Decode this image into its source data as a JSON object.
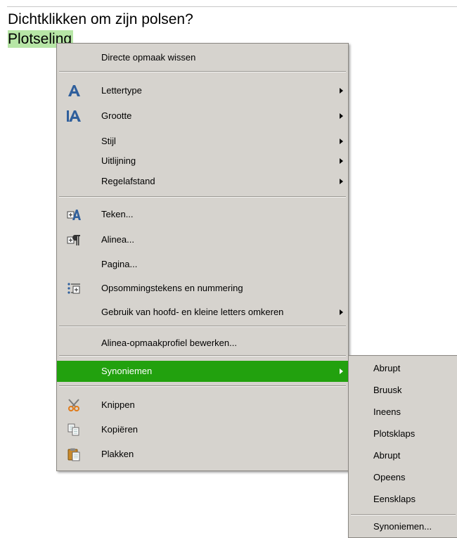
{
  "document": {
    "line1": "Dichtklikken om zijn polsen?",
    "selected_word": "Plotseling"
  },
  "context_menu": {
    "clear_formatting": "Directe opmaak wissen",
    "font": "Lettertype",
    "size": "Grootte",
    "style": "Stijl",
    "alignment": "Uitlijning",
    "line_spacing": "Regelafstand",
    "character": "Teken...",
    "paragraph": "Alinea...",
    "page": "Pagina...",
    "bullets": "Opsommingstekens en nummering",
    "change_case": "Gebruik van hoofd- en kleine letters omkeren",
    "edit_paragraph_style": "Alinea-opmaakprofiel bewerken...",
    "synonyms": "Synoniemen",
    "cut": "Knippen",
    "copy": "Kopiëren",
    "paste": "Plakken",
    "highlight_color": "#22a10e"
  },
  "synonyms_menu": {
    "items": [
      "Abrupt",
      "Bruusk",
      "Ineens",
      "Plotsklaps",
      "Abrupt",
      "Opeens",
      "Eensklaps"
    ],
    "more": "Synoniemen..."
  }
}
